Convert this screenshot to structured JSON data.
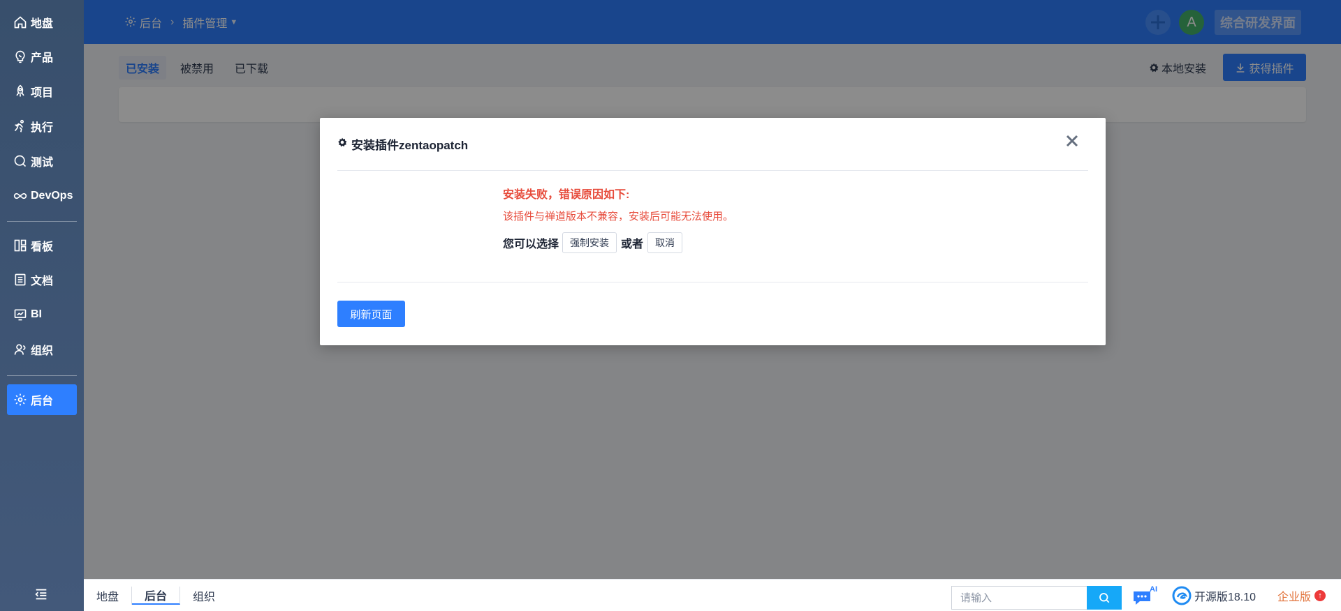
{
  "sidebar": {
    "items": [
      {
        "label": "地盘",
        "icon": "home-icon"
      },
      {
        "label": "产品",
        "icon": "lightbulb-icon"
      },
      {
        "label": "项目",
        "icon": "rocket-icon"
      },
      {
        "label": "执行",
        "icon": "runner-icon"
      },
      {
        "label": "测试",
        "icon": "test-icon"
      },
      {
        "label": "DevOps",
        "icon": "infinity-icon"
      },
      {
        "label": "看板",
        "icon": "kanban-icon"
      },
      {
        "label": "文档",
        "icon": "document-icon"
      },
      {
        "label": "BI",
        "icon": "monitor-icon"
      },
      {
        "label": "组织",
        "icon": "user-icon"
      },
      {
        "label": "后台",
        "icon": "gear-icon"
      }
    ],
    "active": "后台"
  },
  "header": {
    "breadcrumb_root": "后台",
    "breadcrumb_current": "插件管理",
    "avatar_letter": "A",
    "ui_switch_label": "综合研发界面"
  },
  "tabs": [
    "已安装",
    "被禁用",
    "已下载"
  ],
  "active_tab": "已安装",
  "toolbar": {
    "local_install": "本地安装",
    "get_plugin": "获得插件"
  },
  "modal": {
    "title": "安装插件zentaopatch",
    "error_title": "安装失败，错误原因如下:",
    "error_desc": "该插件与禅道版本不兼容，安装后可能无法使用。",
    "choice_prefix": "您可以选择",
    "force_install": "强制安装",
    "or_text": "或者",
    "cancel": "取消",
    "refresh": "刷新页面"
  },
  "footer": {
    "crumbs": [
      "地盘",
      "后台",
      "组织"
    ],
    "active_crumb": "后台",
    "search_placeholder": "请输入",
    "ai_label": "AI",
    "version": "开源版18.10",
    "edition": "企业版"
  },
  "colors": {
    "primary": "#2e7fff",
    "sidebar": "#3c5372",
    "error": "#e74b3b",
    "edition": "#e2733b"
  }
}
